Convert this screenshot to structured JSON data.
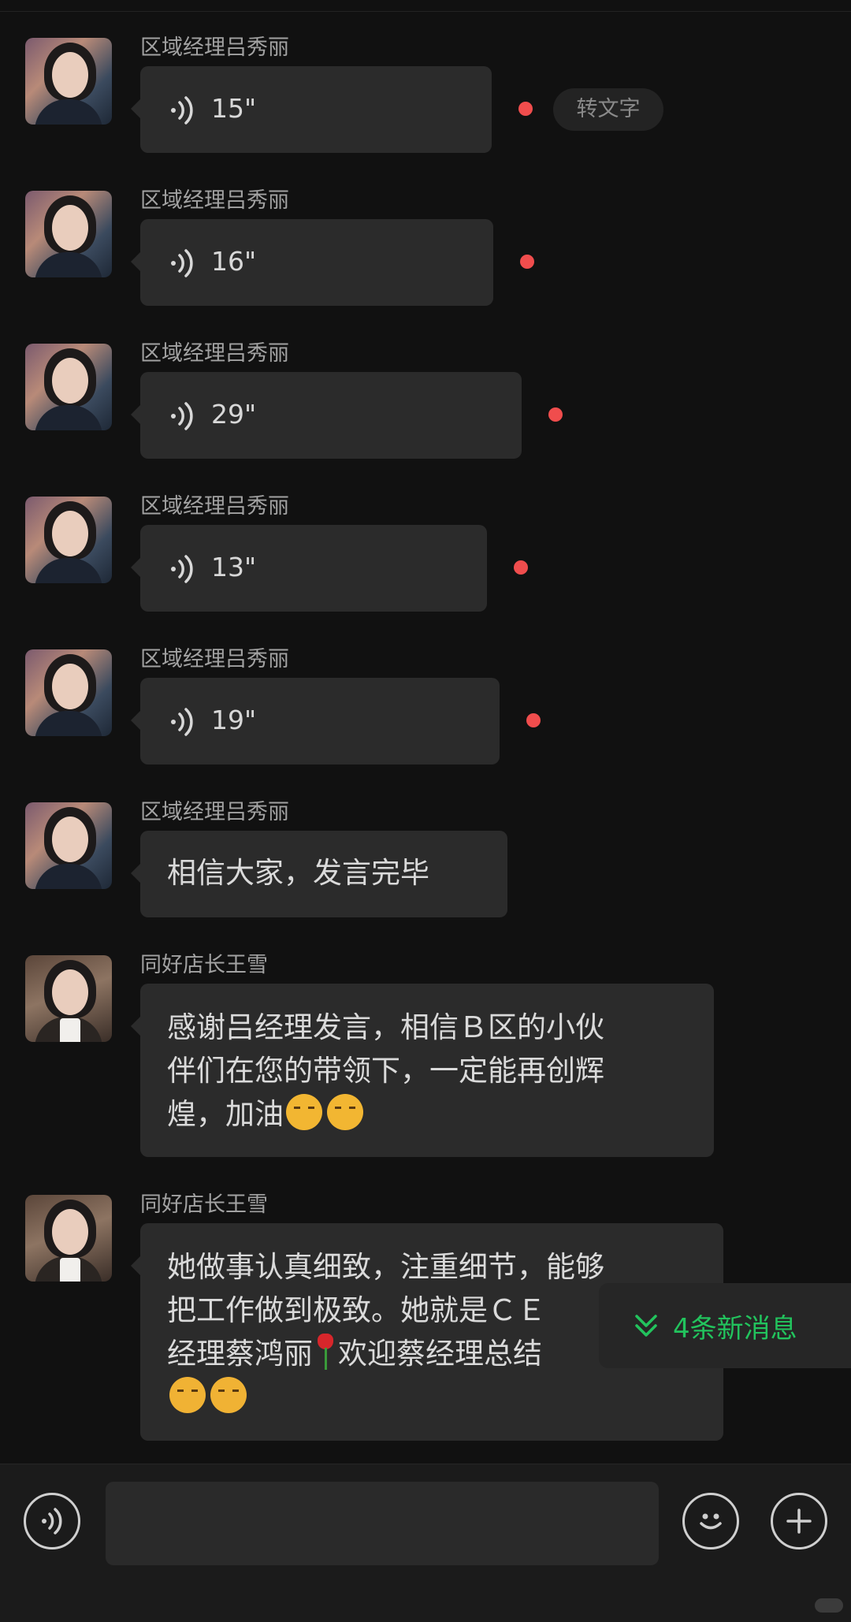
{
  "messages": [
    {
      "sender": "区域经理吕秀丽",
      "type": "voice",
      "duration": "15\"",
      "unread": true,
      "transcribe_label": "转文字"
    },
    {
      "sender": "区域经理吕秀丽",
      "type": "voice",
      "duration": "16\"",
      "unread": true
    },
    {
      "sender": "区域经理吕秀丽",
      "type": "voice",
      "duration": "29\"",
      "unread": true
    },
    {
      "sender": "区域经理吕秀丽",
      "type": "voice",
      "duration": "13\"",
      "unread": true
    },
    {
      "sender": "区域经理吕秀丽",
      "type": "voice",
      "duration": "19\"",
      "unread": true
    },
    {
      "sender": "区域经理吕秀丽",
      "type": "text",
      "lines": [
        "相信大家，发言完毕"
      ]
    },
    {
      "sender": "同好店长王雪",
      "type": "text",
      "lines": [
        "感谢吕经理发言，相信Ｂ区的小伙",
        "伴们在您的带领下，一定能再创辉",
        "煌，加油"
      ],
      "emoji": "saluting-face x2"
    },
    {
      "sender": "同好店长王雪",
      "type": "text",
      "lines": [
        "她做事认真细致，注重细节，能够",
        "把工作做到极致。她就是ＣＥ",
        "经理蔡鸿丽",
        "欢迎蔡经理总结"
      ],
      "emoji": "tulip, hand-over-mouth x2"
    }
  ],
  "new_messages_banner": {
    "label": "4条新消息",
    "color": "#22c35d"
  },
  "input_bar": {
    "placeholder": ""
  },
  "colors": {
    "background": "#111111",
    "bubble": "#2b2b2b",
    "unread_dot": "#f04d4d"
  }
}
